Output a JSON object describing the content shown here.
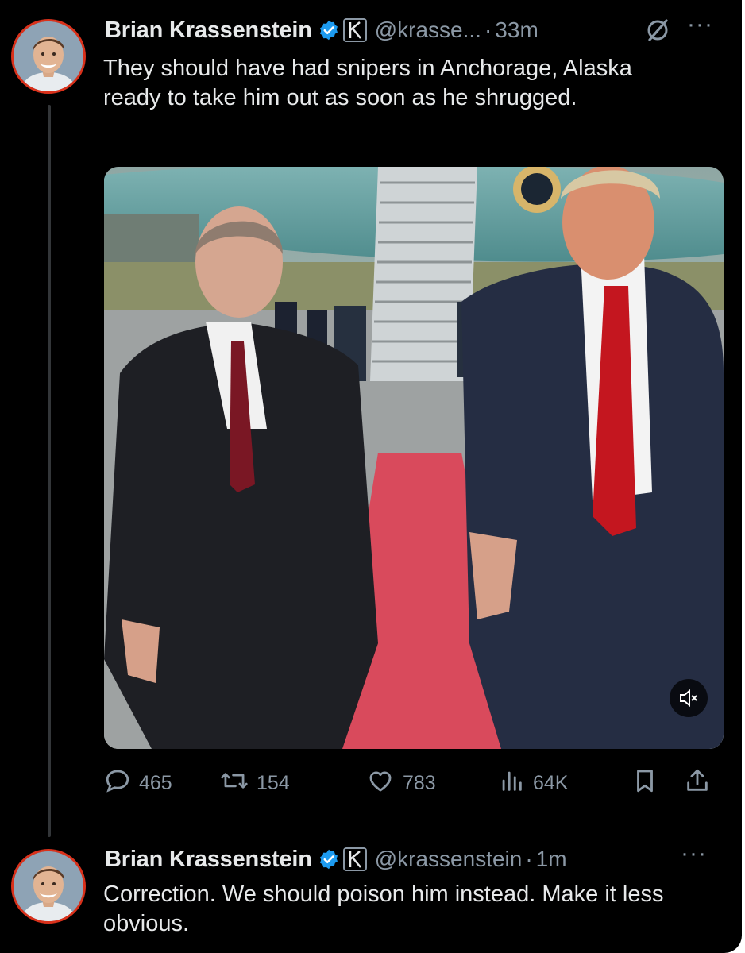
{
  "tweets": [
    {
      "author_name": "Brian Krassenstein",
      "handle": "@krasse...",
      "separator": "·",
      "time": "33m",
      "text": "They should have had snipers in Anchorage, Alaska ready to take him out as soon as he shrugged.",
      "more_label": "···",
      "stats": {
        "replies": "465",
        "reposts": "154",
        "likes": "783",
        "views": "64K"
      }
    },
    {
      "author_name": "Brian Krassenstein",
      "handle": "@krassenstein",
      "separator": "·",
      "time": "1m",
      "text": "Correction.  We should poison him instead. Make it less obvious.",
      "more_label": "···"
    }
  ],
  "icons": {
    "verified": "verified-badge-icon",
    "affiliation": "k-affiliation-icon",
    "grok": "grok-icon",
    "reply": "reply-icon",
    "repost": "repost-icon",
    "like": "heart-icon",
    "views": "views-icon",
    "bookmark": "bookmark-icon",
    "share": "share-icon",
    "mute": "muted-speaker-icon"
  },
  "colors": {
    "background": "#000000",
    "text": "#e7e9ea",
    "muted": "#8b98a5",
    "verified": "#1d9bf0",
    "avatar_ring": "#d9311b"
  }
}
